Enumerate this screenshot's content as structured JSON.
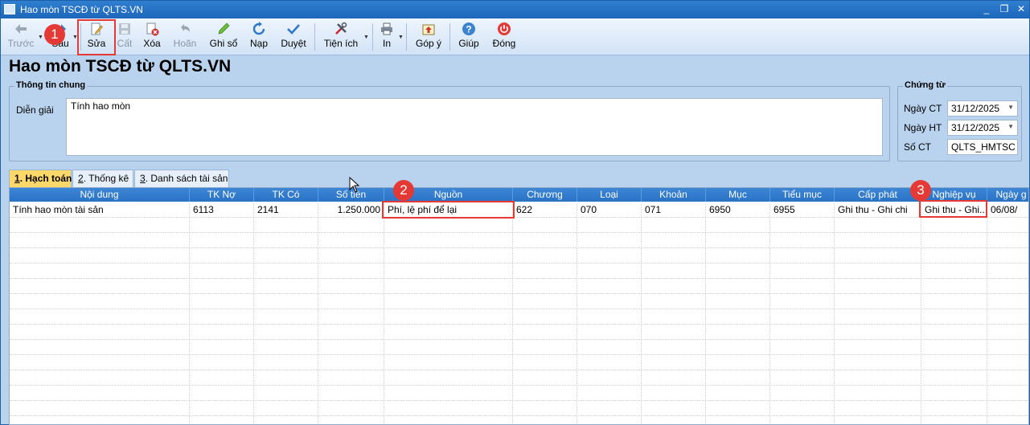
{
  "window": {
    "title": "Hao mòn TSCĐ từ QLTS.VN",
    "minimize": "_",
    "restore": "❐",
    "close": "✕"
  },
  "toolbar": {
    "prev": "Trước",
    "next": "Sau",
    "edit": "Sửa",
    "save": "Cất",
    "delete": "Xóa",
    "undo": "Hoãn",
    "post": "Ghi sổ",
    "reload": "Nạp",
    "approve": "Duyệt",
    "utilities": "Tiện ích",
    "print": "In",
    "feedback": "Góp ý",
    "help": "Giúp",
    "close": "Đóng"
  },
  "annotations": [
    "1",
    "2",
    "3"
  ],
  "page_title": "Hao mòn TSCĐ từ QLTS.VN",
  "general_info": {
    "title": "Thông tin chung",
    "description_label": "Diễn giải",
    "description_value": "Tính hao mòn"
  },
  "voucher": {
    "title": "Chứng từ",
    "doc_date_label": "Ngày CT",
    "doc_date_value": "31/12/2025",
    "post_date_label": "Ngày HT",
    "post_date_value": "31/12/2025",
    "number_label": "Số CT",
    "number_value": "QLTS_HMTSC"
  },
  "tabs": [
    {
      "key": "1",
      "label": "Hạch toán"
    },
    {
      "key": "2",
      "label": "Thống kê"
    },
    {
      "key": "3",
      "label": "Danh sách tài sản"
    }
  ],
  "grid": {
    "columns": [
      "Nội dung",
      "TK Nợ",
      "TK Có",
      "Số tiền",
      "Nguồn",
      "Chương",
      "Loại",
      "Khoản",
      "Mục",
      "Tiểu mục",
      "Cấp phát",
      "Nghiệp vụ",
      "Ngày g"
    ],
    "rows": [
      [
        "Tính hao mòn tài sản",
        "6113",
        "2141",
        "1.250.000",
        "Phí, lệ phí để lại",
        "622",
        "070",
        "071",
        "6950",
        "6955",
        "Ghi thu - Ghi chi",
        "Ghi thu - Ghi...",
        "06/08/"
      ]
    ]
  },
  "colors": {
    "accent": "#2a72c4",
    "annotation": "#e53935",
    "active_tab": "#ffd86a"
  }
}
